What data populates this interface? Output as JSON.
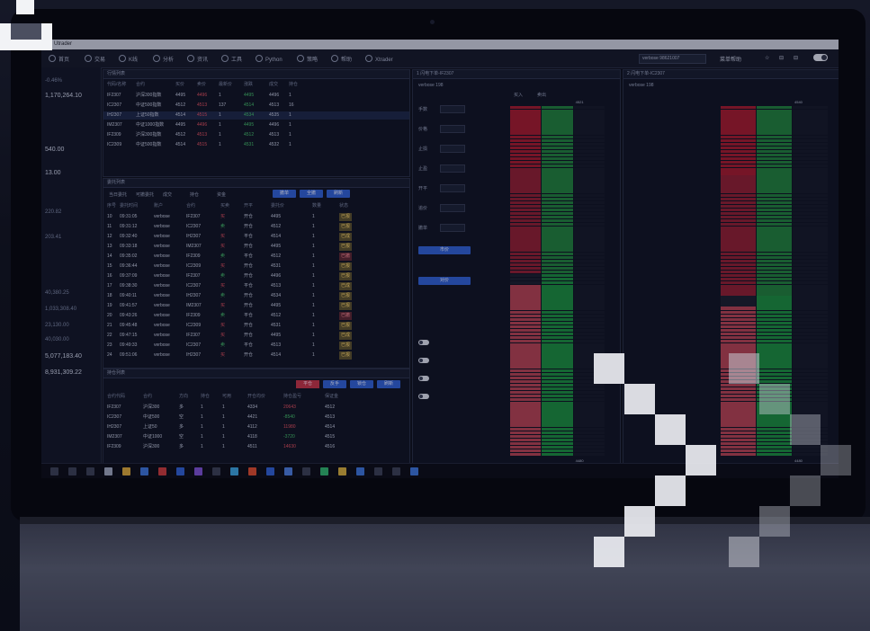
{
  "window": {
    "title": "Utrader"
  },
  "toolbar": {
    "items": [
      "首页",
      "交易",
      "K线",
      "分析",
      "资讯",
      "工具",
      "Python",
      "策略",
      "帮助",
      "Xtrader"
    ],
    "account": "verbose 98621007",
    "right_items": [
      "菜单帮助",
      "☆",
      "⊟",
      "⊟"
    ]
  },
  "rail": {
    "values": [
      "-0.46%",
      "1,170,264.10",
      "540.00",
      "13.00",
      "220.82",
      "203.41",
      "40,380.25",
      "1,033,308.40",
      "23,130.00",
      "40,030.00",
      "5,077,183.40",
      "8,931,309.22"
    ]
  },
  "panels": {
    "quotes": {
      "title": "行情列表",
      "headers": [
        "代码/名称",
        "合约",
        "买价",
        "卖价",
        "最新价",
        "涨跌",
        "成交",
        "持仓"
      ],
      "rows": [
        [
          "IF2307",
          "沪深300指数",
          "4495",
          "4496",
          "1",
          "4495",
          "4496",
          "1"
        ],
        [
          "IC2307",
          "中证500指数",
          "4512",
          "4513",
          "137",
          "4514",
          "4513",
          "16"
        ],
        [
          "IH2307",
          "上证50指数",
          "4514",
          "4515",
          "1",
          "4534",
          "4535",
          "1"
        ],
        [
          "IM2307",
          "中证1000指数",
          "4495",
          "4496",
          "1",
          "4495",
          "4496",
          "1"
        ],
        [
          "IF2309",
          "沪深300指数",
          "4512",
          "4513",
          "1",
          "4512",
          "4513",
          "1"
        ],
        [
          "IC2309",
          "中证500指数",
          "4514",
          "4515",
          "1",
          "4531",
          "4532",
          "1"
        ]
      ]
    },
    "orders": {
      "title": "委托列表",
      "tabs": [
        "当日委托",
        "可撤委托",
        "成交",
        "持仓",
        "资金"
      ],
      "buttons": [
        "撤单",
        "全撤",
        "刷新"
      ],
      "headers": [
        "序号",
        "委托时间",
        "账户",
        "合约",
        "买卖",
        "开平",
        "委托价",
        "数量",
        "状态"
      ],
      "rows": [
        [
          "10",
          "09:31:05",
          "verbose",
          "IF2307",
          "买",
          "开仓",
          "4495",
          "1",
          "已报"
        ],
        [
          "11",
          "09:31:12",
          "verbose",
          "IC2307",
          "卖",
          "开仓",
          "4512",
          "1",
          "已报"
        ],
        [
          "12",
          "09:32:40",
          "verbose",
          "IH2307",
          "买",
          "平仓",
          "4514",
          "1",
          "已成"
        ],
        [
          "13",
          "09:33:18",
          "verbose",
          "IM2307",
          "买",
          "开仓",
          "4495",
          "1",
          "已报"
        ],
        [
          "14",
          "09:35:02",
          "verbose",
          "IF2309",
          "卖",
          "平仓",
          "4512",
          "1",
          "已撤"
        ],
        [
          "15",
          "09:36:44",
          "verbose",
          "IC2309",
          "买",
          "开仓",
          "4531",
          "1",
          "已报"
        ],
        [
          "16",
          "09:37:09",
          "verbose",
          "IF2307",
          "卖",
          "开仓",
          "4496",
          "1",
          "已报"
        ],
        [
          "17",
          "09:38:30",
          "verbose",
          "IC2307",
          "买",
          "平仓",
          "4513",
          "1",
          "已成"
        ],
        [
          "18",
          "09:40:11",
          "verbose",
          "IH2307",
          "卖",
          "开仓",
          "4534",
          "1",
          "已报"
        ],
        [
          "19",
          "09:41:57",
          "verbose",
          "IM2307",
          "买",
          "开仓",
          "4495",
          "1",
          "已报"
        ],
        [
          "20",
          "09:43:26",
          "verbose",
          "IF2309",
          "卖",
          "平仓",
          "4512",
          "1",
          "已撤"
        ],
        [
          "21",
          "09:45:48",
          "verbose",
          "IC2309",
          "买",
          "开仓",
          "4531",
          "1",
          "已报"
        ],
        [
          "22",
          "09:47:15",
          "verbose",
          "IF2307",
          "买",
          "开仓",
          "4495",
          "1",
          "已成"
        ],
        [
          "23",
          "09:49:33",
          "verbose",
          "IC2307",
          "卖",
          "平仓",
          "4513",
          "1",
          "已报"
        ],
        [
          "24",
          "09:51:06",
          "verbose",
          "IH2307",
          "买",
          "开仓",
          "4514",
          "1",
          "已报"
        ]
      ]
    },
    "positions": {
      "title": "持仓列表",
      "buttons": [
        "平仓",
        "反手",
        "锁仓",
        "刷新"
      ],
      "headers": [
        "合约代码",
        "合约",
        "方向",
        "持仓",
        "可用",
        "开仓均价",
        "持仓盈亏",
        "保证金"
      ],
      "rows": [
        [
          "IF2307",
          "沪深300",
          "多",
          "1",
          "1",
          "4334",
          "20643",
          "4512"
        ],
        [
          "IC2307",
          "中证500",
          "空",
          "1",
          "1",
          "4421",
          "-8540",
          "4513"
        ],
        [
          "IH2307",
          "上证50",
          "多",
          "1",
          "1",
          "4112",
          "11980",
          "4514"
        ],
        [
          "IM2307",
          "中证1000",
          "空",
          "1",
          "1",
          "4118",
          "-3720",
          "4515"
        ],
        [
          "IF2309",
          "沪深300",
          "多",
          "1",
          "1",
          "4511",
          "14630",
          "4516"
        ]
      ]
    },
    "ladder1": {
      "title": "1 闪电下单-IF2307",
      "account": "verbose 198",
      "tabs": [
        "买入",
        "卖出"
      ],
      "labels": [
        "手数",
        "价格",
        "止损",
        "止盈",
        "开平",
        "追价",
        "撤单"
      ],
      "buttons": [
        "市价",
        "对价"
      ],
      "prices_top": "4521",
      "prices_bottom": "4480"
    },
    "ladder2": {
      "title": "2 闪电下单-IC2307",
      "account": "verbose 198",
      "prices_top": "4540",
      "prices_bottom": "4480"
    }
  }
}
